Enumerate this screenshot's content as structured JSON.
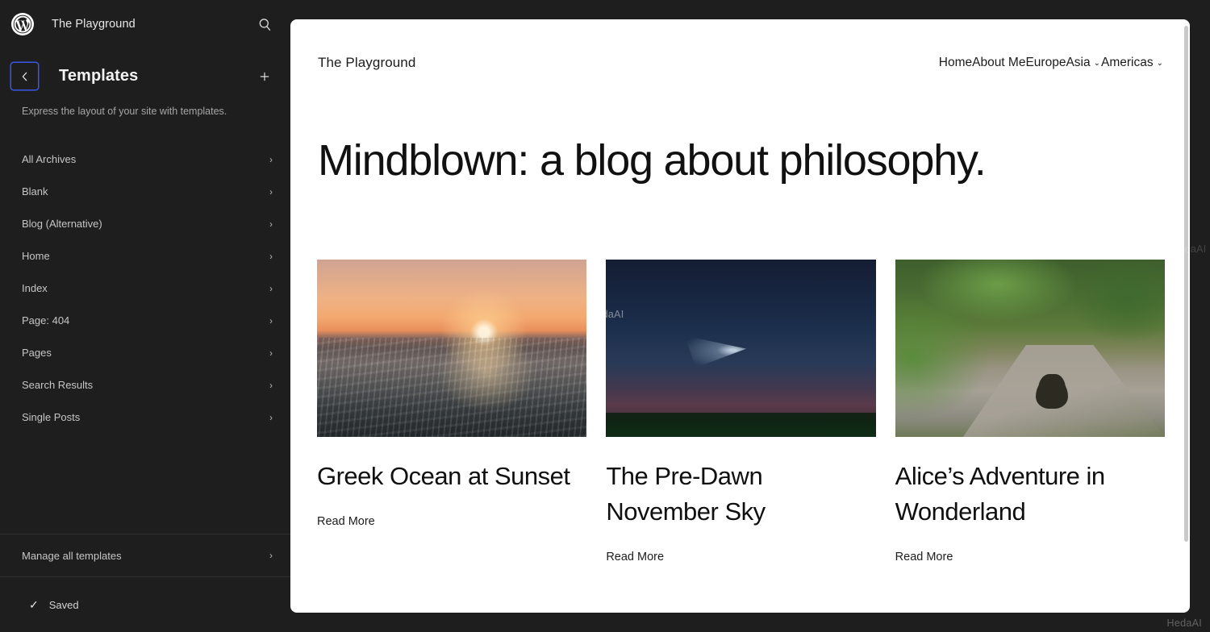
{
  "sidebar": {
    "logo_icon": "wordpress-logo-icon",
    "site_name": "The Playground",
    "search_icon": "search-icon",
    "back_icon": "chevron-left-icon",
    "panel_title": "Templates",
    "add_icon": "plus-icon",
    "description": "Express the layout of your site with templates.",
    "items": [
      {
        "label": "All Archives",
        "chevron": "›"
      },
      {
        "label": "Blank",
        "chevron": "›"
      },
      {
        "label": "Blog (Alternative)",
        "chevron": "›"
      },
      {
        "label": "Home",
        "chevron": "›"
      },
      {
        "label": "Index",
        "chevron": "›"
      },
      {
        "label": "Page: 404",
        "chevron": "›"
      },
      {
        "label": "Pages",
        "chevron": "›"
      },
      {
        "label": "Search Results",
        "chevron": "›"
      },
      {
        "label": "Single Posts",
        "chevron": "›"
      }
    ],
    "manage": {
      "label": "Manage all templates",
      "chevron": "›"
    },
    "status": {
      "check": "✓",
      "label": "Saved"
    }
  },
  "canvas": {
    "site_title": "The Playground",
    "nav": [
      {
        "label": "Home",
        "caret": ""
      },
      {
        "label": "About Me",
        "caret": ""
      },
      {
        "label": "Europe",
        "caret": ""
      },
      {
        "label": "Asia",
        "caret": "⌄"
      },
      {
        "label": "Americas",
        "caret": "⌄"
      }
    ],
    "hero_heading": "Mindblown: a blog about philosophy.",
    "posts": [
      {
        "title": "Greek Ocean at Sunset",
        "read_more": "Read More",
        "image_alt": "ocean-sunset-photo"
      },
      {
        "title": "The Pre-Dawn November Sky",
        "read_more": "Read More",
        "image_alt": "pre-dawn-sky-photo"
      },
      {
        "title": "Alice’s Adventure in Wonderland",
        "read_more": "Read More",
        "image_alt": "forest-path-rabbit-photo"
      }
    ]
  },
  "watermarks": {
    "bottom_right": "HedaAI",
    "middle": "HedaAI",
    "side": "HedaAI"
  },
  "colors": {
    "sidebar_bg": "#1e1e1e",
    "canvas_bg": "#ffffff",
    "focus_blue": "#3858e9",
    "text_primary": "#f2f2f2",
    "text_secondary": "#a7a7a7"
  }
}
